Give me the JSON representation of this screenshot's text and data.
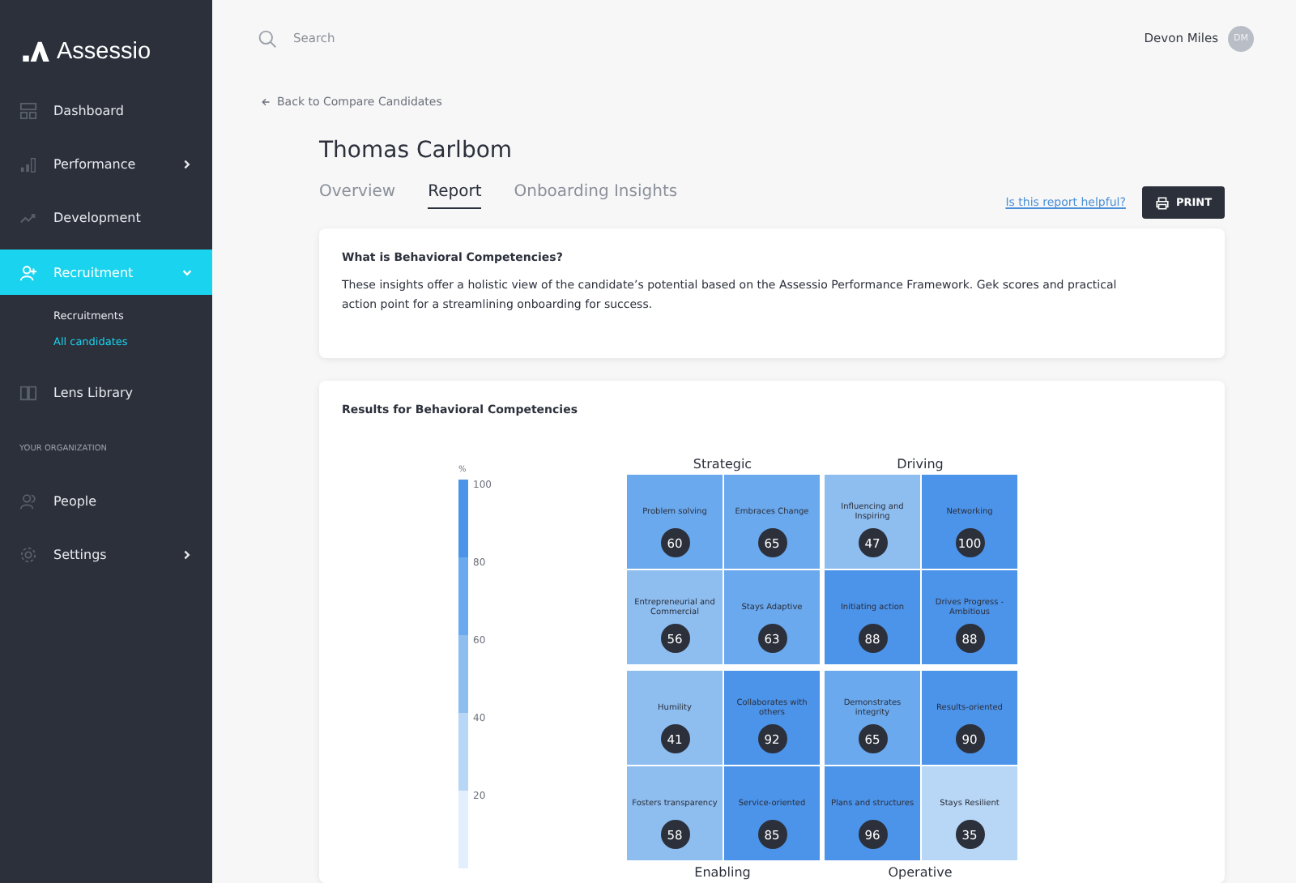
{
  "brand": "Assessio",
  "nav": [
    {
      "label": "Dashboard",
      "selected": false
    },
    {
      "label": "Performance",
      "selected": false,
      "expanded": false
    },
    {
      "label": "Development",
      "selected": false
    },
    {
      "label": "Recruitment",
      "selected": true,
      "expanded": true,
      "children": [
        {
          "label": "Recruitments",
          "selected": false
        },
        {
          "label": "All candidates",
          "selected": true
        }
      ]
    },
    {
      "label": "Lens Library",
      "selected": false
    }
  ],
  "org_section": {
    "title": "YOUR ORGANIZATION",
    "items": [
      {
        "label": "People",
        "selected": false
      },
      {
        "label": "Settings",
        "selected": false,
        "expanded": false
      }
    ]
  },
  "search": {
    "placeholder": "Search"
  },
  "user": {
    "name": "Devon Miles",
    "initials": "DM"
  },
  "back_link": "Back to Compare Candidates",
  "candidate": "Thomas Carlbom",
  "tabs": [
    {
      "label": "Overview",
      "selected": false
    },
    {
      "label": "Report",
      "selected": true
    },
    {
      "label": "Onboarding Insights",
      "selected": false
    }
  ],
  "helpful_link": "Is this report helpful?",
  "print_button": "PRINT",
  "info_card": {
    "title": "What is Behavioral Competencies?",
    "text": "These insights offer a holistic view of the candidate’s potential based on the Assessio Performance Framework. Gek scores and practical action point for a streamlining onboarding for success."
  },
  "results": {
    "title": "Results for Behavioral Competencies",
    "scale": {
      "unit": "%",
      "ticks": [
        "100",
        "80",
        "60",
        "40",
        "20"
      ]
    },
    "quadrants": [
      {
        "title": "Strategic",
        "cells": [
          {
            "label": "Problem solving",
            "score": "60",
            "color": "#6aa9ee"
          },
          {
            "label": "Embraces Change",
            "score": "65",
            "color": "#6aa9ee"
          },
          {
            "label": "Entrepreneurial and Commercial",
            "score": "56",
            "color": "#8ebdf0"
          },
          {
            "label": "Stays Adaptive",
            "score": "63",
            "color": "#6aa9ee"
          }
        ]
      },
      {
        "title": "Driving",
        "cells": [
          {
            "label": "Influencing and Inspiring",
            "score": "47",
            "color": "#8ebdf0"
          },
          {
            "label": "Networking",
            "score": "100",
            "color": "#4c93ea"
          },
          {
            "label": "Initiating action",
            "score": "88",
            "color": "#4c93ea"
          },
          {
            "label": "Drives Progress - Ambitious",
            "score": "88",
            "color": "#4c93ea"
          }
        ]
      },
      {
        "title": "Enabling",
        "cells": [
          {
            "label": "Humility",
            "score": "41",
            "color": "#8ebdf0"
          },
          {
            "label": "Collaborates with others",
            "score": "92",
            "color": "#4c93ea"
          },
          {
            "label": "Fosters transparency",
            "score": "58",
            "color": "#8ebdf0"
          },
          {
            "label": "Service-oriented",
            "score": "85",
            "color": "#4c93ea"
          }
        ]
      },
      {
        "title": "Operative",
        "cells": [
          {
            "label": "Demonstrates integrity",
            "score": "65",
            "color": "#6aa9ee"
          },
          {
            "label": "Results-oriented",
            "score": "90",
            "color": "#4c93ea"
          },
          {
            "label": "Plans and structures",
            "score": "96",
            "color": "#4c93ea"
          },
          {
            "label": "Stays Resilient",
            "score": "35",
            "color": "#b8d6f6"
          }
        ]
      }
    ]
  }
}
